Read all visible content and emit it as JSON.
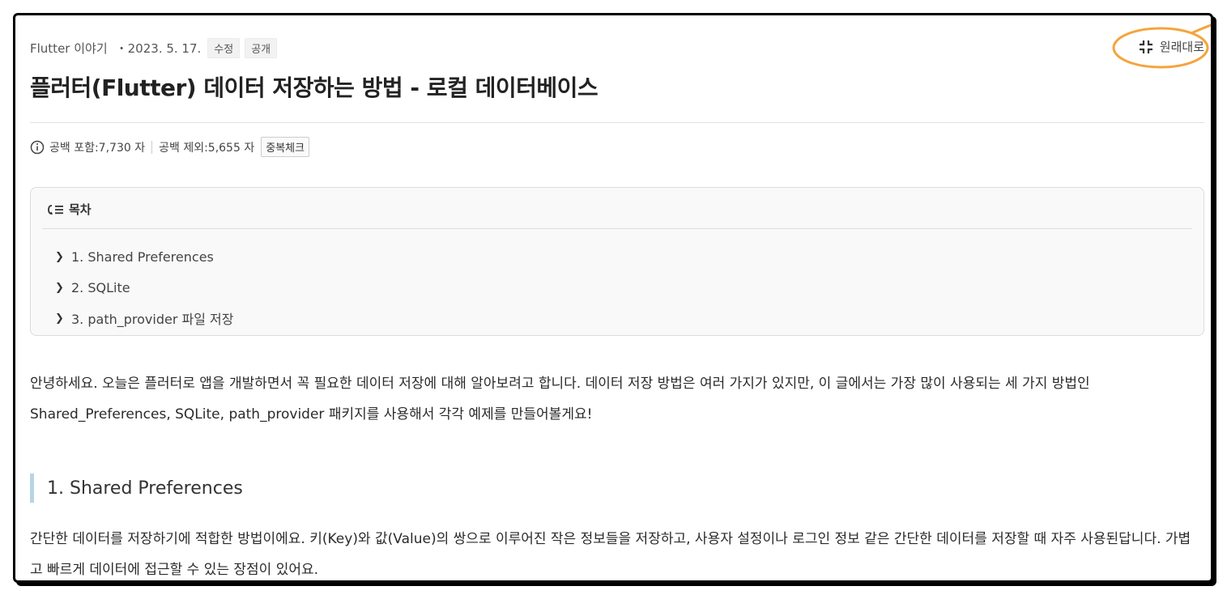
{
  "header": {
    "category": "Flutter 이야기",
    "date": "・2023. 5. 17.",
    "edit_label": "수정",
    "visibility_label": "공개",
    "restore_label": "원래대로",
    "highlight_color": "#f5a43c"
  },
  "post": {
    "title": "플러터(Flutter) 데이터 저장하는 방법 - 로컬 데이터베이스"
  },
  "counts": {
    "with_spaces": "공백 포함:7,730 자",
    "without_spaces": "공백 제외:5,655 자",
    "duplicate_check_label": "중복체크"
  },
  "toc": {
    "heading": "목차",
    "items": [
      {
        "label": "1. Shared Preferences"
      },
      {
        "label": "2. SQLite"
      },
      {
        "label": "3. path_provider 파일 저장"
      }
    ]
  },
  "body": {
    "intro": "안녕하세요. 오늘은 플러터로 앱을 개발하면서 꼭 필요한 데이터 저장에 대해 알아보려고 합니다. 데이터 저장 방법은 여러 가지가 있지만, 이 글에서는 가장 많이 사용되는 세 가지 방법인 Shared_Preferences, SQLite, path_provider 패키지를 사용해서 각각 예제를 만들어볼게요!",
    "section1_title": "1. Shared Preferences",
    "section1_text": "간단한 데이터를 저장하기에 적합한 방법이에요. 키(Key)와 값(Value)의 쌍으로 이루어진 작은 정보들을 저장하고, 사용자 설정이나 로그인 정보 같은 간단한 데이터를 저장할 때 자주 사용된답니다. 가볍고 빠르게 데이터에 접근할 수 있는 장점이 있어요."
  },
  "colors": {
    "section_bar": "#b7d4e6",
    "toc_background": "#f9f9f9"
  }
}
